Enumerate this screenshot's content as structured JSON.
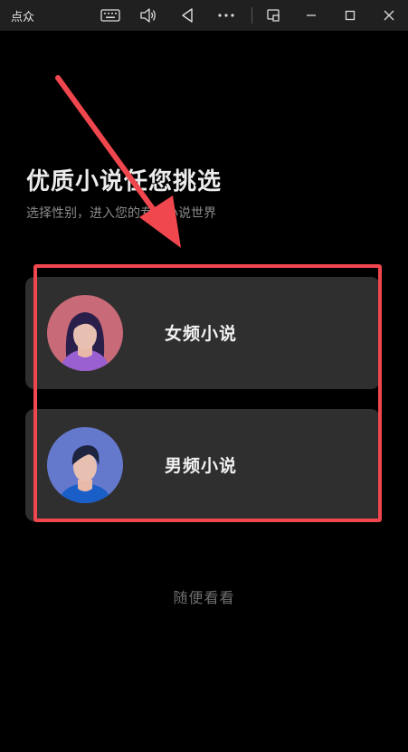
{
  "titlebar": {
    "app_title": "点众",
    "buttons": [
      "keyboard-icon",
      "volume-icon",
      "back-icon",
      "more-icon",
      "screenshot-icon",
      "minimize-icon",
      "maximize-icon",
      "close-icon"
    ]
  },
  "main": {
    "headline": "优质小说任您挑选",
    "subline": "选择性别，进入您的专属小说世界",
    "options": [
      {
        "label": "女频小说",
        "icon": "female-avatar"
      },
      {
        "label": "男频小说",
        "icon": "male-avatar"
      }
    ],
    "skip_label": "随便看看"
  },
  "colors": {
    "background": "#000000",
    "card": "#2f2f2f",
    "highlight": "#f0464e",
    "female_avatar_bg": "#c86a78",
    "male_avatar_bg": "#6478cc"
  }
}
